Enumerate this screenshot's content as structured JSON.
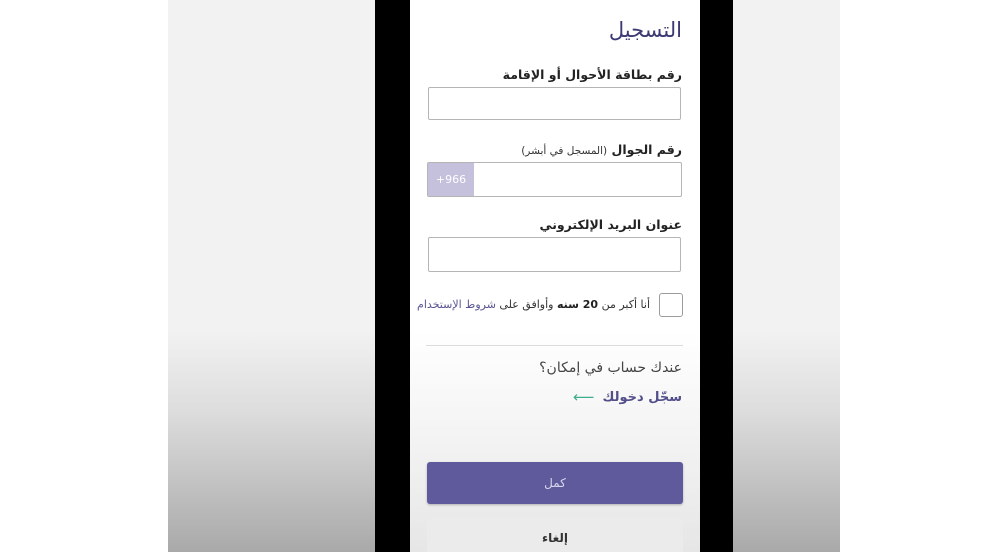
{
  "form": {
    "title": "التسجيل",
    "id_label": "رقم بطاقة الأحوال أو الإقامة",
    "mobile_label": "رقم الجوال",
    "mobile_sublabel": "(المسجل في أبشر)",
    "country_code": "+966",
    "email_label": "عنوان البريد الإلكتروني",
    "agree_prefix": "أنا أكبر من ",
    "agree_age": "20 سنه",
    "agree_middle": " وأوافق على ",
    "agree_terms": "شروط الإستخدام"
  },
  "account": {
    "question": "عندك حساب في إمكان؟",
    "login_link": "سجّل دخولك",
    "login_arrow": "⟵"
  },
  "buttons": {
    "primary": "كمل",
    "cancel": "إلغاء"
  },
  "colors": {
    "accent": "#5e5a9b",
    "title": "#3d3a73",
    "arrow": "#3fae8c",
    "prefix_bg": "#c5c1dd"
  }
}
